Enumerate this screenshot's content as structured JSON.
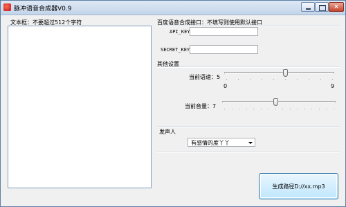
{
  "window": {
    "title": "脉冲语音合成器V0.9"
  },
  "titlebar_buttons": {
    "close_glyph": "×"
  },
  "text_area": {
    "label": "文本框：不要超过512个字符",
    "value": ""
  },
  "baidu": {
    "group_label": "百度语音合成接口：不填写则使用默认接口",
    "api_key_label": "API_KEY",
    "api_key_value": "",
    "secret_key_label": "SECRET_KEY",
    "secret_key_value": ""
  },
  "settings": {
    "group_label": "其他设置",
    "speed": {
      "label": "当前语速：5",
      "value": 5,
      "min_label": "0",
      "max_label": "9",
      "min": 0,
      "max": 9
    },
    "volume": {
      "label": "当前音量：7",
      "value": 7,
      "min": 0,
      "max": 15
    }
  },
  "speaker": {
    "group_label": "发声人",
    "selected": "有感情的度丫丫"
  },
  "generate_button": {
    "label": "生成路径D://xx.mp3"
  }
}
